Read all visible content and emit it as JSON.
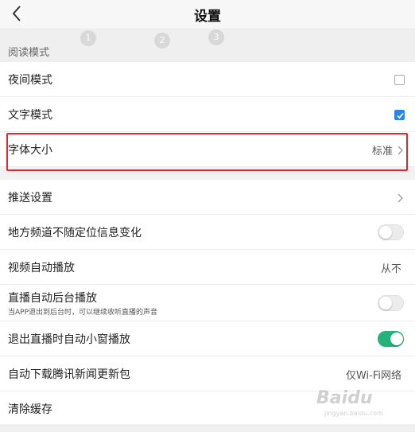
{
  "header": {
    "title": "设置"
  },
  "section_reading": {
    "label": "阅读模式"
  },
  "rows": {
    "night_mode": {
      "label": "夜间模式"
    },
    "text_mode": {
      "label": "文字模式"
    },
    "font_size": {
      "label": "字体大小",
      "value": "标准"
    },
    "push_settings": {
      "label": "推送设置"
    },
    "local_channel": {
      "label": "地方频道不随定位信息变化"
    },
    "video_autoplay": {
      "label": "视频自动播放",
      "value": "从不"
    },
    "live_background": {
      "label": "直播自动后台播放",
      "sublabel": "当APP退出到后台时，可以继续收听直播的声音"
    },
    "live_miniwindow": {
      "label": "退出直播时自动小窗播放"
    },
    "auto_download": {
      "label": "自动下载腾讯新闻更新包",
      "value": "仅Wi-Fi网络"
    },
    "clear_cache": {
      "label": "清除缓存"
    }
  },
  "states": {
    "night_mode_checked": false,
    "text_mode_checked": true,
    "local_channel_on": false,
    "live_background_on": false,
    "live_miniwindow_on": true
  },
  "step_markers": [
    "1",
    "2",
    "3"
  ],
  "watermark": {
    "text": "Baidu",
    "sub": "jingyan.baidu.com"
  },
  "colors": {
    "accent_blue": "#2b85e4",
    "toggle_green": "#21b37a",
    "highlight_red": "#e0262e"
  }
}
